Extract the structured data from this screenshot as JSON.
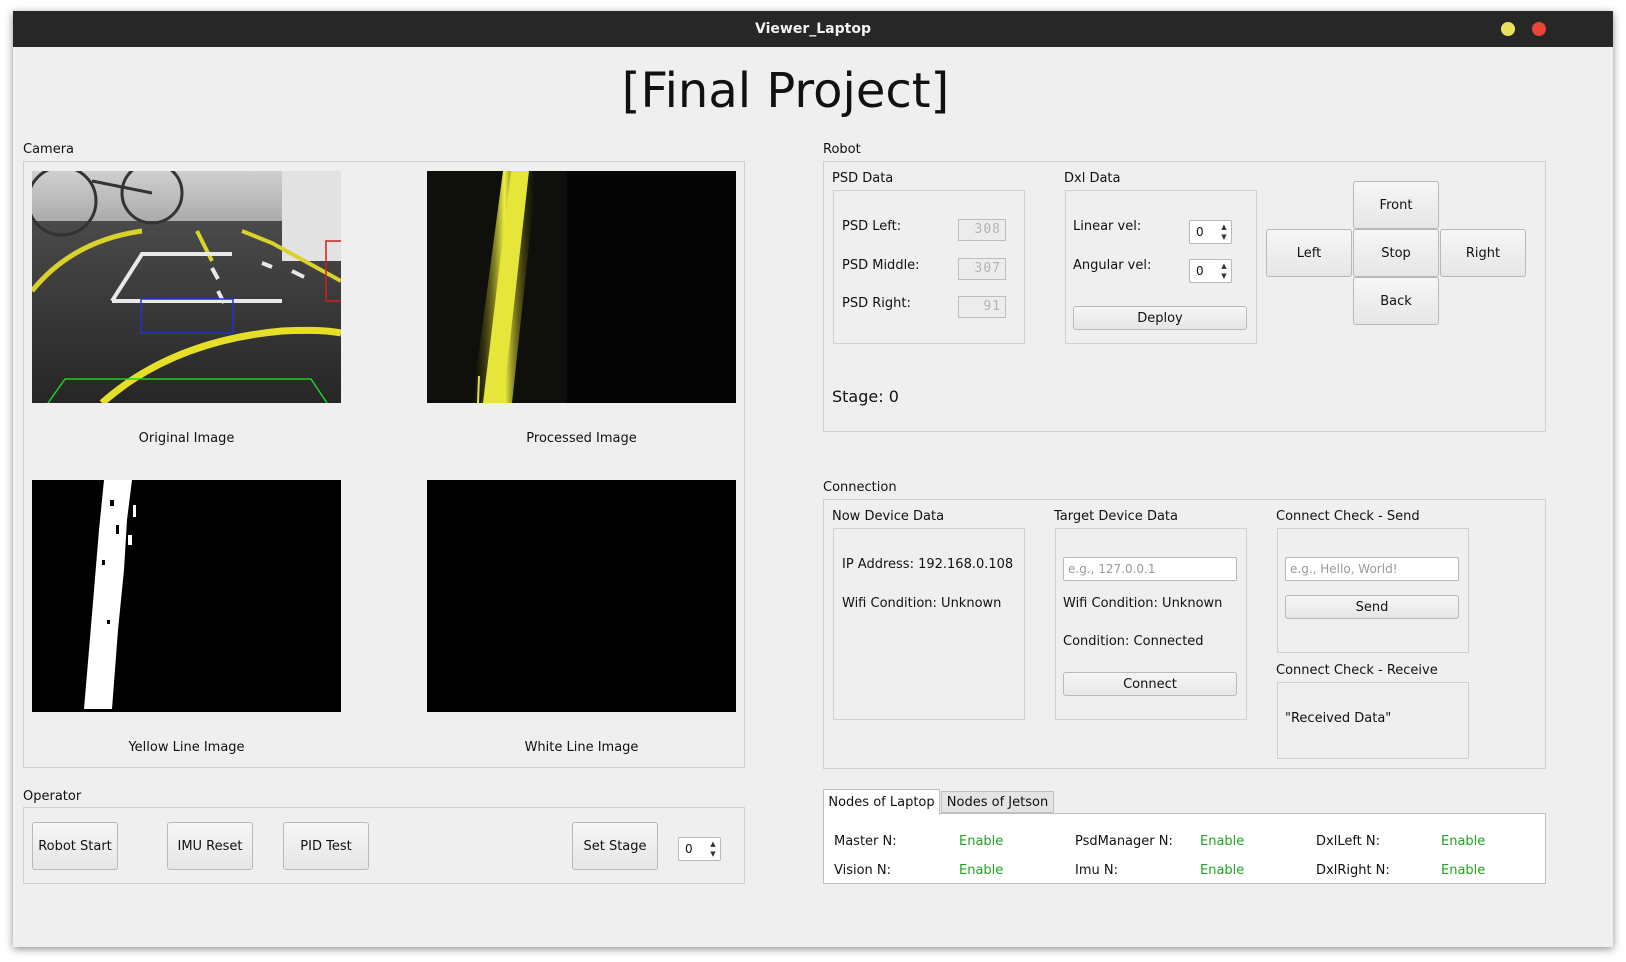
{
  "window": {
    "title": "Viewer_Laptop",
    "min_color": "#e8e35a",
    "close_color": "#e8443a"
  },
  "page_title": "[Final Project]",
  "camera": {
    "title": "Camera",
    "images": [
      {
        "caption": "Original Image"
      },
      {
        "caption": "Processed Image"
      },
      {
        "caption": "Yellow Line Image"
      },
      {
        "caption": "White Line Image"
      }
    ]
  },
  "operator": {
    "title": "Operator",
    "robot_start": "Robot Start",
    "imu_reset": "IMU Reset",
    "pid_test": "PID Test",
    "set_stage": "Set Stage",
    "stage_value": "0"
  },
  "robot": {
    "title": "Robot",
    "psd": {
      "title": "PSD Data",
      "left_label": "PSD Left:",
      "left_value": "308",
      "middle_label": "PSD Middle:",
      "middle_value": "307",
      "right_label": "PSD Right:",
      "right_value": "91"
    },
    "dxl": {
      "title": "Dxl Data",
      "linear_label": "Linear vel:",
      "linear_value": "0",
      "angular_label": "Angular vel:",
      "angular_value": "0",
      "deploy": "Deploy"
    },
    "dpad": {
      "front": "Front",
      "left": "Left",
      "stop": "Stop",
      "right": "Right",
      "back": "Back"
    },
    "stage_text": "Stage: 0"
  },
  "connection": {
    "title": "Connection",
    "now": {
      "title": "Now Device Data",
      "ip": "IP Address: 192.168.0.108",
      "wifi": "Wifi Condition: Unknown"
    },
    "target": {
      "title": "Target Device Data",
      "ip_placeholder": "e.g., 127.0.0.1",
      "wifi": "Wifi Condition: Unknown",
      "condition": "Condition: Connected",
      "connect": "Connect"
    },
    "send": {
      "title": "Connect Check - Send",
      "placeholder": "e.g., Hello, World!",
      "button": "Send"
    },
    "receive": {
      "title": "Connect Check - Receive",
      "text": "\"Received Data\""
    }
  },
  "nodes": {
    "tabs": [
      "Nodes of Laptop",
      "Nodes of Jetson"
    ],
    "rows": [
      [
        {
          "name": "Master N:",
          "status": "Enable"
        },
        {
          "name": "PsdManager N:",
          "status": "Enable"
        },
        {
          "name": "DxlLeft N:",
          "status": "Enable"
        }
      ],
      [
        {
          "name": "Vision N:",
          "status": "Enable"
        },
        {
          "name": "Imu N:",
          "status": "Enable"
        },
        {
          "name": "DxlRight N:",
          "status": "Enable"
        }
      ]
    ]
  }
}
